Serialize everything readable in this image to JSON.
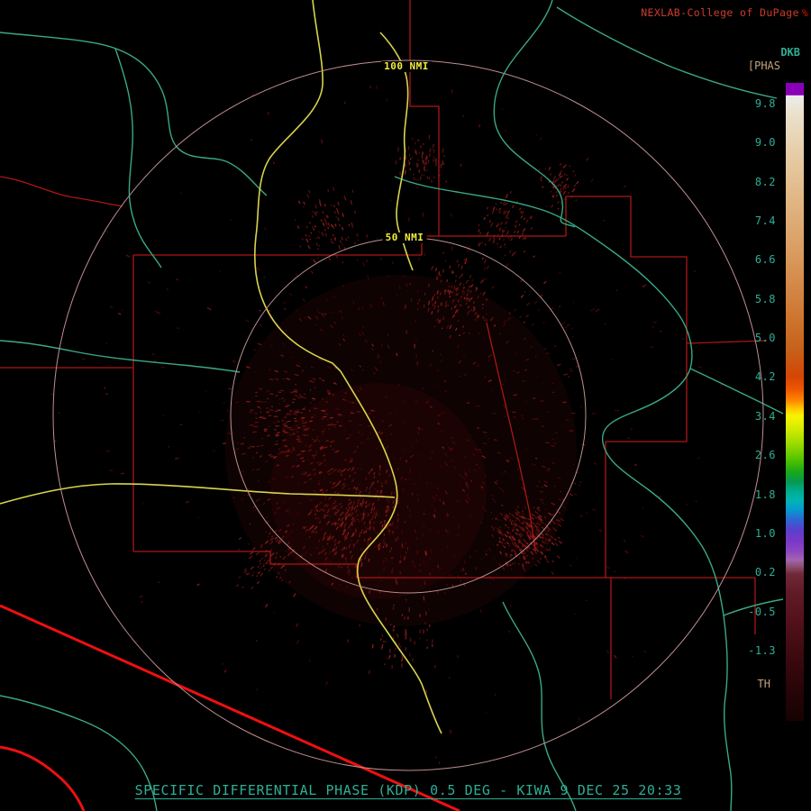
{
  "header": {
    "title": "NEXLAB-College of DuPage",
    "badge": "%"
  },
  "colorbar": {
    "unit": "DKB",
    "phase_label": "[PHAS",
    "threshold_label": "TH",
    "ticks": [
      "9.8",
      "9.0",
      "8.2",
      "7.4",
      "6.6",
      "5.8",
      "5.0",
      "4.2",
      "3.4",
      "2.6",
      "1.8",
      "1.0",
      "0.2",
      "-0.5",
      "-1.3"
    ],
    "gradient_stops": [
      [
        0,
        "#8a00b8"
      ],
      [
        1.9,
        "#8a00b8"
      ],
      [
        2,
        "#ececec"
      ],
      [
        4.5,
        "#ebe2d0"
      ],
      [
        10,
        "#e7d0ac"
      ],
      [
        18,
        "#e1b786"
      ],
      [
        27,
        "#d99a5e"
      ],
      [
        35,
        "#d07c38"
      ],
      [
        42,
        "#c66018"
      ],
      [
        46,
        "#d44606"
      ],
      [
        48,
        "#ee5500"
      ],
      [
        49.8,
        "#fc8800"
      ],
      [
        51,
        "#ffc400"
      ],
      [
        52.2,
        "#f8f400"
      ],
      [
        54,
        "#d8ec00"
      ],
      [
        56.5,
        "#9cdc00"
      ],
      [
        59,
        "#54c400"
      ],
      [
        61,
        "#18a818"
      ],
      [
        62.5,
        "#089850"
      ],
      [
        64,
        "#00ac90"
      ],
      [
        65.5,
        "#00b4b4"
      ],
      [
        67,
        "#0898d0"
      ],
      [
        68.5,
        "#3064d4"
      ],
      [
        70,
        "#5840cc"
      ],
      [
        71.8,
        "#7838c8"
      ],
      [
        73.5,
        "#9048c0"
      ],
      [
        74.8,
        "#a464b0"
      ],
      [
        75.8,
        "#8c5070"
      ],
      [
        77,
        "#702838"
      ],
      [
        80,
        "#601a26"
      ],
      [
        84,
        "#54121c"
      ],
      [
        88,
        "#440c12"
      ],
      [
        92,
        "#34070c"
      ],
      [
        96,
        "#240406"
      ],
      [
        100,
        "#160203"
      ]
    ]
  },
  "rings": {
    "outer_label": "100 NMI",
    "inner_label": "50 NMI"
  },
  "footer": {
    "status": "SPECIFIC DIFFERENTIAL PHASE (KDP) 0.5 DEG - KIWA 9 DEC 25 20:33"
  },
  "palette": {
    "teal": "#2fae96",
    "tan": "#c2a27e",
    "yellow": "#f0ee3c",
    "title_red": "#cc3b2a",
    "bright_red": "#f21500"
  },
  "map": {
    "colors": {
      "highway": "#d8d44c",
      "river": "#3aa886",
      "county": "#ac1616",
      "border": "#ee1010",
      "range_ring": "#c09090",
      "echo_palette": [
        "#3a0606",
        "#4a0a0a",
        "#5a0e0e",
        "#6c1212",
        "#7e1818",
        "#8e1c1c"
      ]
    }
  }
}
